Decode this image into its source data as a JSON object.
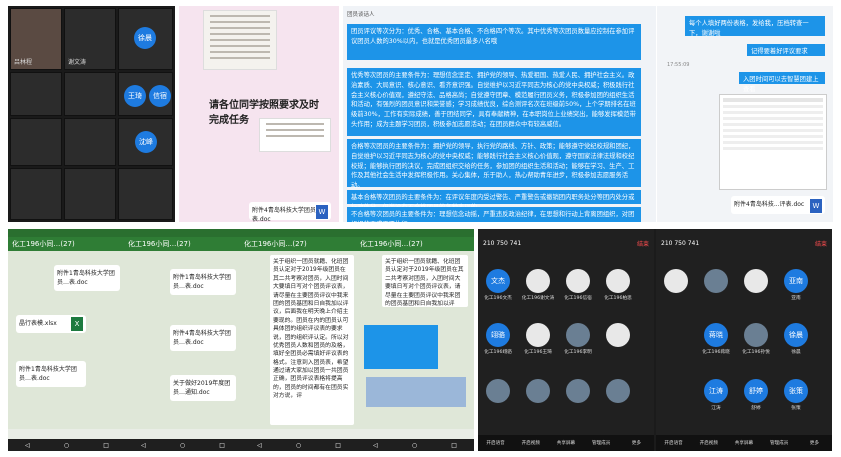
{
  "panel_a": {
    "names": [
      "吕林程",
      "谢文涛",
      "徐晨",
      "王琦",
      "信宿",
      "沈峰"
    ]
  },
  "panel_b": {
    "handwriting": "请各位同学按照要求及时完成任务",
    "file_name": "附件4青岛科技大学团员...表.doc"
  },
  "panel_c": {
    "top_bar": "团员评议等次分为：优秀、合格、基本合格、不合格四个等次。其中优秀等次团员数量应控制在参加评议团员人数的30%以内，也就是优秀团员最多八名哦",
    "para1": "优秀等次团员的主要条件为：理想信念坚定、拥护党的领导、热爱祖国、热爱人民、拥护社会主义。政治素质、大局意识、核心意识、看齐意识强。自觉维护以习近平同志为核心的党中央权威；积极践行社会主义核心价值观，遵纪守法、品格高尚；自觉遵守团章、模范履行团员义务，积极参加团的组织生活和活动，有强烈的团员意识和荣誉感；学习成绩优良，综合测评名次在班级前50%，上个学期排名在班级前30%，工作有实际成绩，善于团结同学，具有奉献精神，在本职岗位上业绩突出，能够发挥模范带头作用；成为主题学习团员，积极参加志愿活动；在团员群众中有较高威信。",
    "para2": "合格等次团员的主要条件为：拥护党的领导，执行党的路线、方针、政策；能够遵守党纪校规和团纪，自觉维护以习近平同志为核心的党中央权威；能够践行社会主义核心价值观，遵守国家法律法规和校纪校规；能够执行团的决议，完成团组织交给的任务，参加团的组织生活和活动；能够在学习、生产、工作及其他社会生活中发挥积极作用。关心集体，乐于助人，热心帮助青年进步，积极参加志愿服务活动。",
    "para3": "基本合格等次团员的主要条件为：在评议年度内受过警告、严重警告或撤销团内职务处分等团内处分或行政处分，但尚没有不合格团员的各种表现的。",
    "para4": "不合格等次团员的主要条件为：理想信念动摇，严重违反政治纪律，在思想和行动上背离团组织，对团组织的要求不愿执行、",
    "doc_name": "附件4青岛科技...评表.doc",
    "chat_head": "团员谈话人",
    "time": "17:55:09"
  },
  "panel_d": {
    "msg1": "每个人填好两份表格，发给我，压档转查一下，谢谢啦",
    "msg2": "记得要着好评议要求",
    "msg3": "入团时间可以去智慧团建上查看",
    "file": "附件4青岛科技...评表.doc"
  },
  "chat_group": {
    "title": "化工196小同…(27)",
    "files": [
      "附件1青岛科技大学团员…表.doc",
      "附件4青岛科技大学团员…表.doc",
      "晶行表模.xlsx",
      "附件1青岛科技大学团员…表.doc",
      "关于做好2019年度团员…通知.doc"
    ],
    "long_text": "关于组织一团员就籍、化班团员认定对于2019年级团员在其二共考察对团员，入团时间大要填日写对个团员评议表，请尽量在主要团员评议中我来团的团员基团和日自我加以评议，后面我在明天晚上介绍主要现的。团员在内的团员认可具体团的组织评议表的要求说，团的组织评认定。所以对优秀团员人数和团员的及格，填好全团员必需填好评议表的格式。注意到入团员表，希望通过请大家加以团员一共团员正确，团员评议表格将提高的，团员的时间都有在团员实对方说，评"
  },
  "meeting": {
    "meeting_id": "210 750 741",
    "leave": "结束",
    "participants": [
      {
        "name": "文杰",
        "label": "化工196文杰"
      },
      {
        "name": "",
        "label": "化工196谢文涛"
      },
      {
        "name": "",
        "label": "化工196信宿"
      },
      {
        "name": "",
        "label": "化工196柏思"
      },
      {
        "name": "亚南",
        "label": "亚南"
      },
      {
        "name": "翊骆",
        "label": "化工196翊骆"
      },
      {
        "name": "",
        "label": "化工196王琦"
      },
      {
        "name": "",
        "label": "化工196李明"
      },
      {
        "name": "蒋晓",
        "label": "化工196蒋晓"
      },
      {
        "name": "",
        "label": "化工196孙悦"
      },
      {
        "name": "江涛",
        "label": "江涛"
      },
      {
        "name": "舒婷",
        "label": "舒婷"
      },
      {
        "name": "徐晨",
        "label": "徐晨"
      },
      {
        "name": "张策",
        "label": "张策"
      }
    ],
    "controls": [
      "开启语音",
      "开启视频",
      "共享屏幕",
      "管理成员",
      "更多"
    ]
  },
  "colors": {
    "blue_bubble": "#1d94e8",
    "phone_green": "#2f7d35",
    "meeting_bg": "#1b1b1b"
  }
}
